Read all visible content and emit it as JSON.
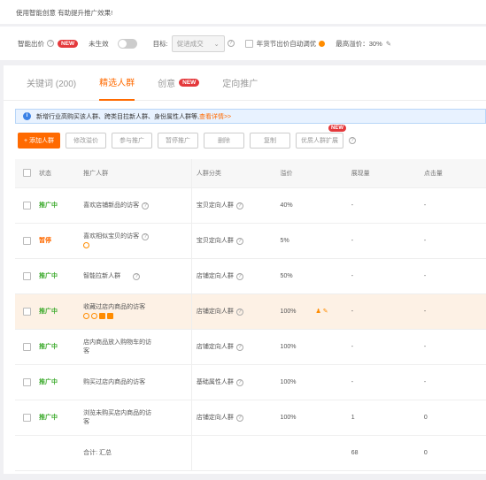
{
  "tip": "使用智能创意 有助提升推广效果!",
  "bar": {
    "smart_bid": "智能出价",
    "new": "NEW",
    "not_effective": "未生效",
    "target_label": "目标:",
    "target_value": "促进成交",
    "holiday": "年货节出价自动调优",
    "max_bid": "最高溢价：30%"
  },
  "tabs": [
    {
      "label": "关键词 (200)"
    },
    {
      "label": "精选人群"
    },
    {
      "label": "创意"
    },
    {
      "label": "定向推广"
    }
  ],
  "tab_new": "NEW",
  "notice": {
    "text": "新增行业高购买该人群、跨类目拉新人群、身份属性人群等,",
    "link": "查看详情>>"
  },
  "buttons": {
    "add": "+ 添加人群",
    "modify": "修改溢价",
    "join": "参与推广",
    "pause": "暂停推广",
    "delete": "删除",
    "copy": "复制",
    "expand": "优质人群扩展",
    "expand_badge": "NEW"
  },
  "columns": [
    "状态",
    "推广人群",
    "人群分类",
    "溢价",
    "展现量",
    "点击量"
  ],
  "rows": [
    {
      "status": "推广中",
      "name": "喜欢店铺新品的访客",
      "category": "宝贝定向人群",
      "bid": "40%",
      "views": "-",
      "clicks": "-"
    },
    {
      "status": "暂停",
      "name": "喜欢相似宝贝的访客",
      "category": "宝贝定向人群",
      "bid": "5%",
      "views": "-",
      "clicks": "-"
    },
    {
      "status": "推广中",
      "name": "智能拉新人群",
      "category": "店铺定向人群",
      "bid": "50%",
      "views": "-",
      "clicks": "-"
    },
    {
      "status": "推广中",
      "name": "收藏过店内商品的访客",
      "category": "店铺定向人群",
      "bid": "100%",
      "views": "-",
      "clicks": "-"
    },
    {
      "status": "推广中",
      "name": "店内商品放入购物车的访客",
      "category": "店铺定向人群",
      "bid": "100%",
      "views": "-",
      "clicks": "-"
    },
    {
      "status": "推广中",
      "name": "购买过店内商品的访客",
      "category": "基础属性人群",
      "bid": "100%",
      "views": "-",
      "clicks": "-"
    },
    {
      "status": "推广中",
      "name": "浏览未购买店内商品的访客",
      "category": "店铺定向人群",
      "bid": "100%",
      "views": "1",
      "clicks": "0"
    }
  ],
  "total": {
    "label": "合计: 汇总",
    "views": "68",
    "clicks": "0"
  },
  "colors": {
    "accent": "#ff6a00",
    "green": "#3caa2c",
    "new_badge": "#e4393c"
  }
}
